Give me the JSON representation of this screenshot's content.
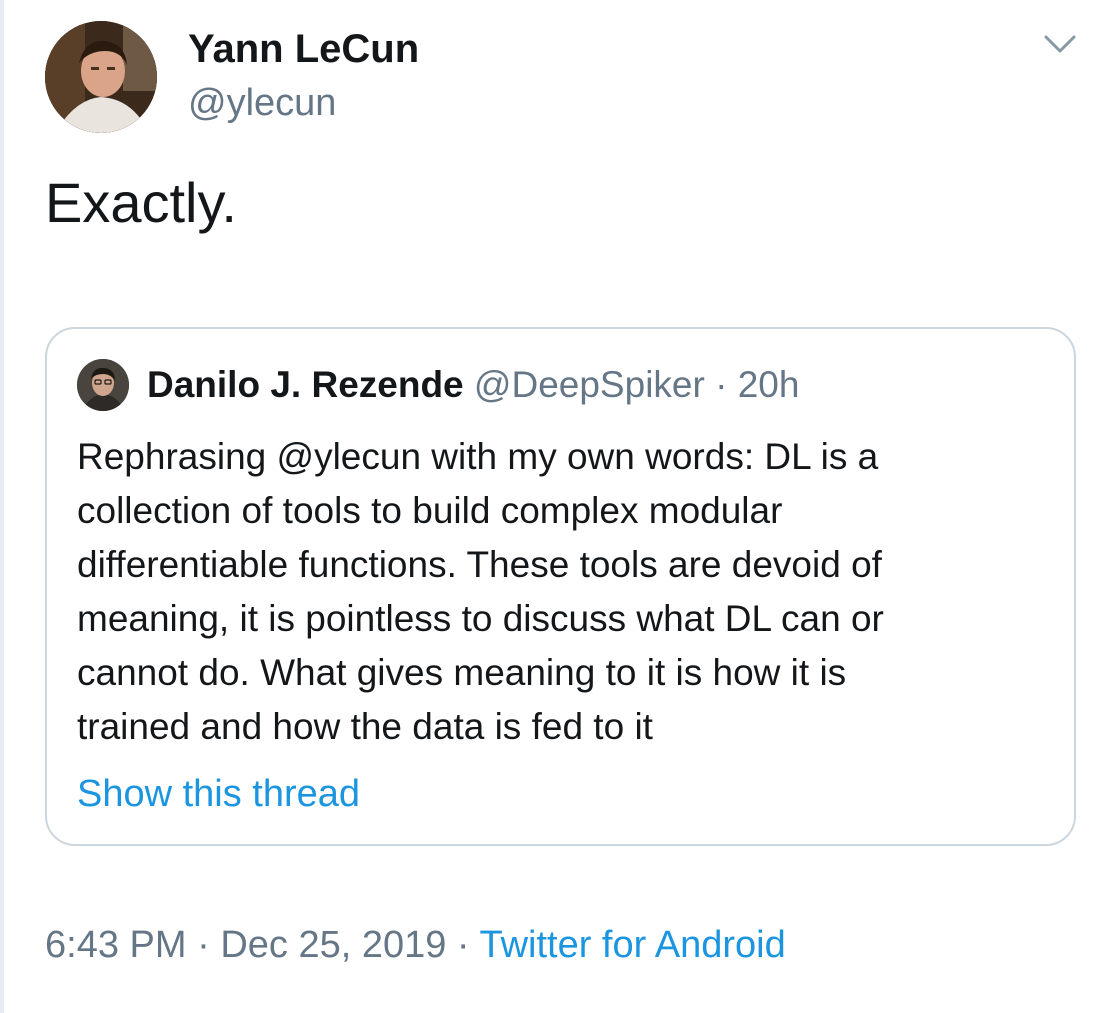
{
  "author": {
    "name": "Yann LeCun",
    "handle": "@ylecun"
  },
  "tweet": {
    "text": "Exactly."
  },
  "quoted_tweet": {
    "name": "Danilo J. Rezende",
    "handle": "@DeepSpiker",
    "separator": " · ",
    "age": "20h",
    "lines": [
      "Rephrasing @ylecun with my own words: DL is a",
      "collection of tools to build complex modular",
      "differentiable functions. These tools are devoid of",
      "meaning, it is pointless to discuss what DL can or",
      "cannot do. What gives meaning to it is how it is",
      "trained and how the data is fed to it"
    ],
    "show_thread_label": "Show this thread"
  },
  "footer": {
    "time": "6:43 PM",
    "separator": " · ",
    "date": "Dec 25, 2019",
    "source": "Twitter for Android"
  },
  "colors": {
    "text": "#14171a",
    "secondary": "#657786",
    "link": "#1b95e0",
    "border": "#ccd6dd"
  },
  "icons": {
    "menu": "chevron-down-icon"
  }
}
